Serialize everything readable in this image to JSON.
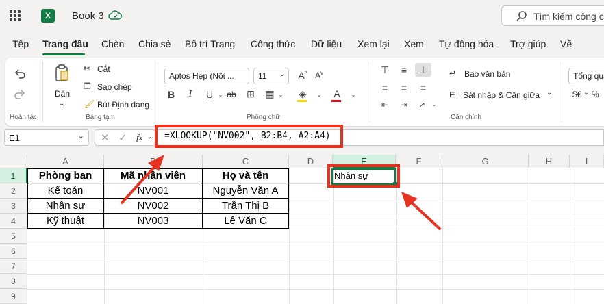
{
  "app": {
    "name": "Excel",
    "logo_letter": "X",
    "book_title": "Book 3"
  },
  "search": {
    "placeholder": "Tìm kiếm công cụ"
  },
  "tabs": [
    "Tệp",
    "Trang đầu",
    "Chèn",
    "Bố trí Trang",
    "Công thức",
    "Dữ liệu",
    "Xem lại",
    "Xem",
    "Tự động hóa",
    "Trợ giúp",
    "Vẽ"
  ],
  "active_tab": "Trang đầu",
  "ribbon": {
    "undo_group": "Hoàn tác",
    "clipboard": {
      "paste": "Dán",
      "cut": "Cắt",
      "copy": "Sao chép",
      "format_painter": "Bút Định dạng",
      "group": "Bảng tạm"
    },
    "font": {
      "name": "Aptos Hẹp (Nội ...",
      "size": "11",
      "group": "Phông chữ",
      "bold": "B",
      "italic": "I",
      "underline": "U",
      "strike": "ab"
    },
    "alignment": {
      "wrap": "Bao văn bản",
      "merge": "Sát nhập & Căn giữa",
      "group": "Căn chỉnh"
    },
    "number": {
      "format": "Tổng quát",
      "currency": "$€"
    }
  },
  "formula_bar": {
    "name_box": "E1",
    "fx": "fx",
    "formula": "=XLOOKUP(\"NV002\", B2:B4, A2:A4)"
  },
  "columns": [
    "A",
    "B",
    "C",
    "D",
    "E",
    "F",
    "G",
    "H",
    "I"
  ],
  "rows": [
    "1",
    "2",
    "3",
    "4",
    "5",
    "6",
    "7",
    "8",
    "9"
  ],
  "table": {
    "headers": [
      "Phòng ban",
      "Mã nhân viên",
      "Họ và tên"
    ],
    "rows": [
      [
        "Kế toán",
        "NV001",
        "Nguyễn Văn A"
      ],
      [
        "Nhân sự",
        "NV002",
        "Trần Thị B"
      ],
      [
        "Kỹ thuật",
        "NV003",
        "Lê Văn C"
      ]
    ]
  },
  "result_cell": {
    "ref": "E1",
    "value": "Nhân sự"
  },
  "colors": {
    "brand_green": "#107c41",
    "highlight_red": "#e8311f"
  }
}
